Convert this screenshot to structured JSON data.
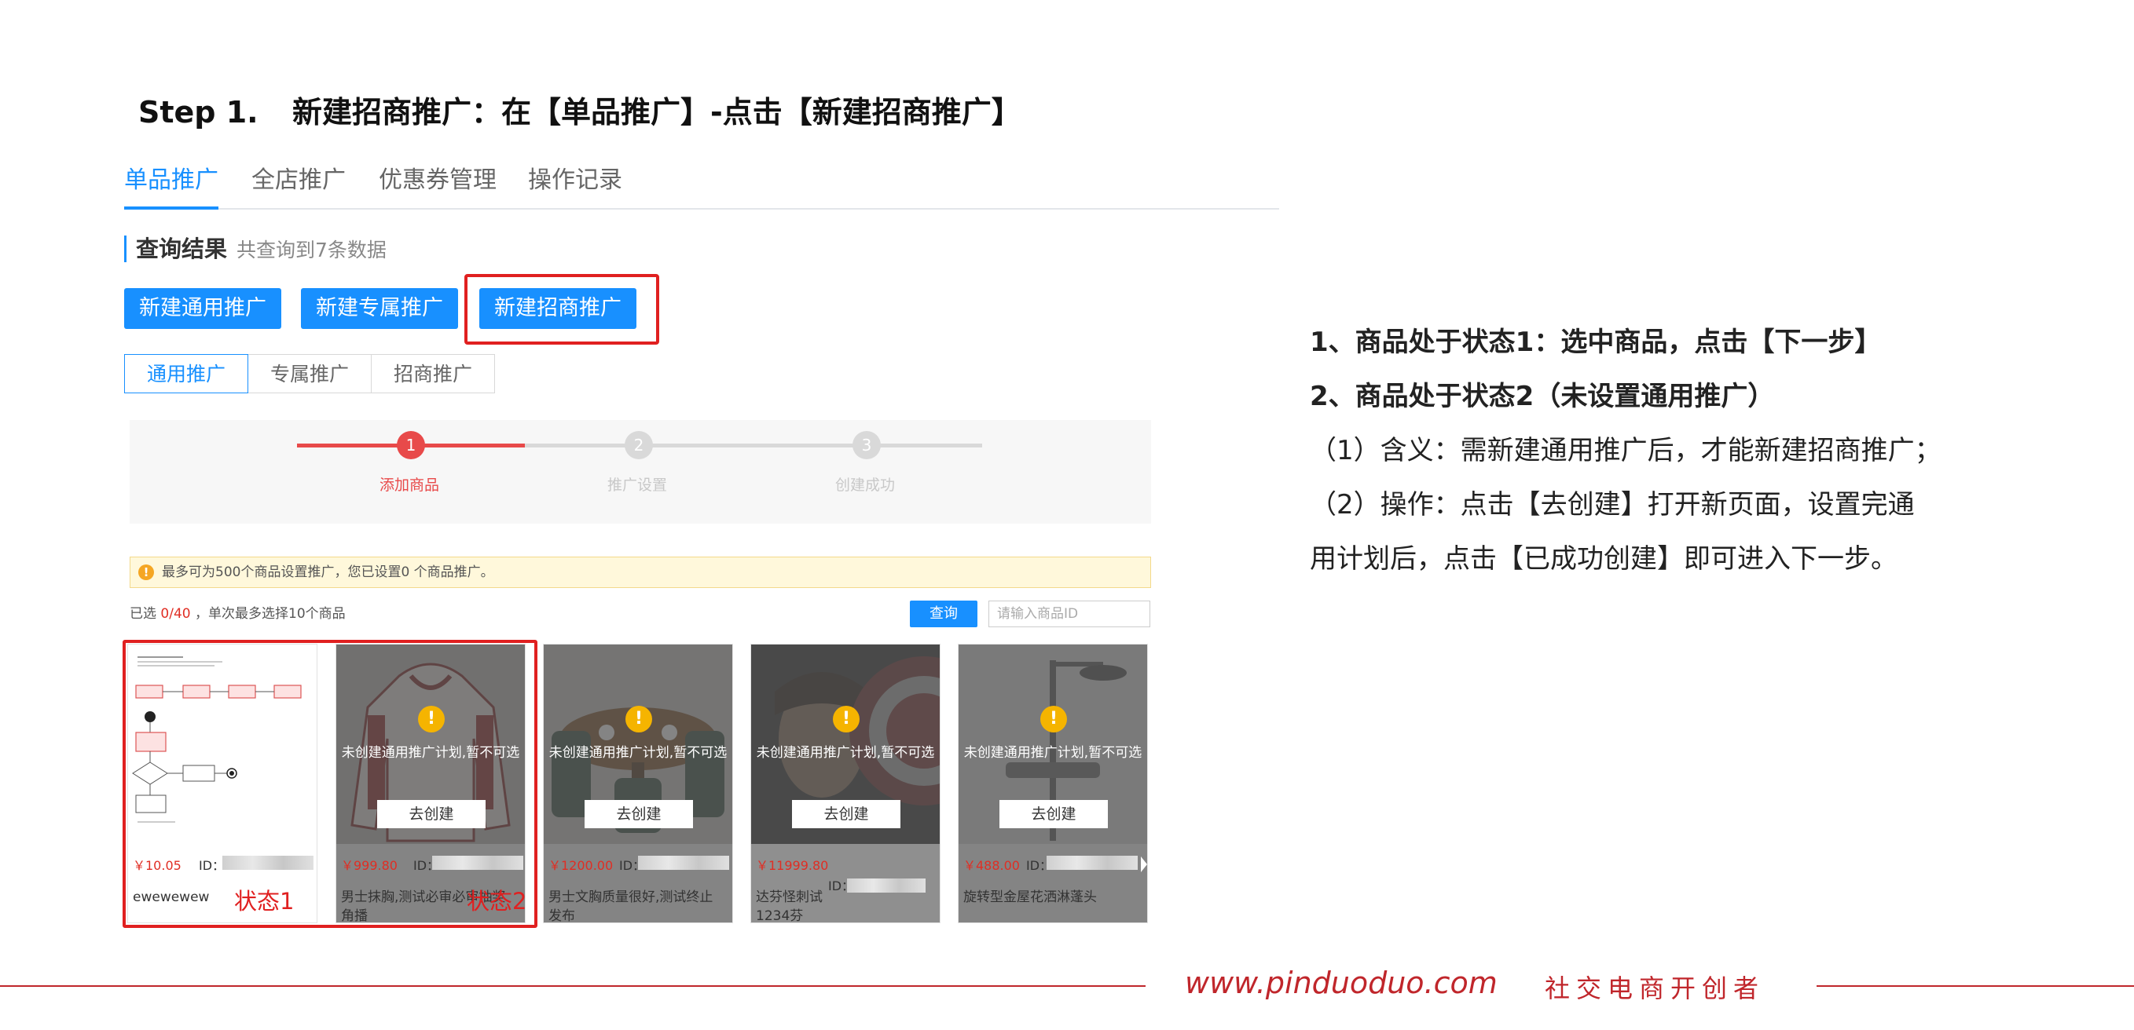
{
  "header": {
    "step": "Step 1.",
    "title": "新建招商推广：在【单品推广】-点击【新建招商推广】"
  },
  "top_tabs": [
    "单品推广",
    "全店推广",
    "优惠券管理",
    "操作记录"
  ],
  "query": {
    "title": "查询结果",
    "count": "共查询到7条数据"
  },
  "buttons": {
    "new_general": "新建通用推广",
    "new_exclusive": "新建专属推广",
    "new_merchant": "新建招商推广"
  },
  "sub_tabs": [
    "通用推广",
    "专属推广",
    "招商推广"
  ],
  "steps": [
    {
      "num": "1",
      "label": "添加商品"
    },
    {
      "num": "2",
      "label": "推广设置"
    },
    {
      "num": "3",
      "label": "创建成功"
    }
  ],
  "notice": "最多可为500个商品设置推广，您已设置0 个商品推广。",
  "selection": {
    "prefix": "已选 ",
    "count": "0/40",
    "suffix": " ，单次最多选择10个商品"
  },
  "query_button": "查询",
  "search_placeholder": "请输入商品ID",
  "cards": [
    {
      "price": "￥10.05",
      "id_label": "ID：",
      "name": "ewewewew",
      "overlay": false
    },
    {
      "price": "￥999.80",
      "id_label": "ID：",
      "name": "男士抹胸,测试必审必审抽奖角播",
      "overlay": true,
      "message": "未创建通用推广计划,暂不可选",
      "action": "去创建"
    },
    {
      "price": "￥1200.00",
      "id_label": "ID：",
      "name": "男士文胸质量很好,测试终止发布",
      "overlay": true,
      "message": "未创建通用推广计划,暂不可选",
      "action": "去创建"
    },
    {
      "price": "￥11999.80",
      "id_label": "ID：",
      "name": "达芬怪刺试1234芬",
      "overlay": true,
      "message": "未创建通用推广计划,暂不可选",
      "action": "去创建"
    },
    {
      "price": "￥488.00",
      "id_label": "ID：",
      "name": "旋转型金屋花洒淋蓬头",
      "overlay": true,
      "message": "未创建通用推广计划,暂不可选",
      "action": "去创建"
    }
  ],
  "state_labels": {
    "state1": "状态1",
    "state2": "状态2"
  },
  "notes": [
    "1、商品处于状态1：选中商品，点击【下一步】",
    "2、商品处于状态2（未设置通用推广）",
    "（1）含义：需新建通用推广后，才能新建招商推广；",
    "（2）操作：点击【去创建】打开新页面，设置完通",
    "用计划后，点击【已成功创建】即可进入下一步。"
  ],
  "footer": {
    "url": "www.pinduoduo.com",
    "slogan": "社交电商开创者"
  },
  "colors": {
    "accent": "#1890ff",
    "highlight": "#e02020",
    "brand_red": "#c0262b",
    "price": "#e02e24"
  }
}
